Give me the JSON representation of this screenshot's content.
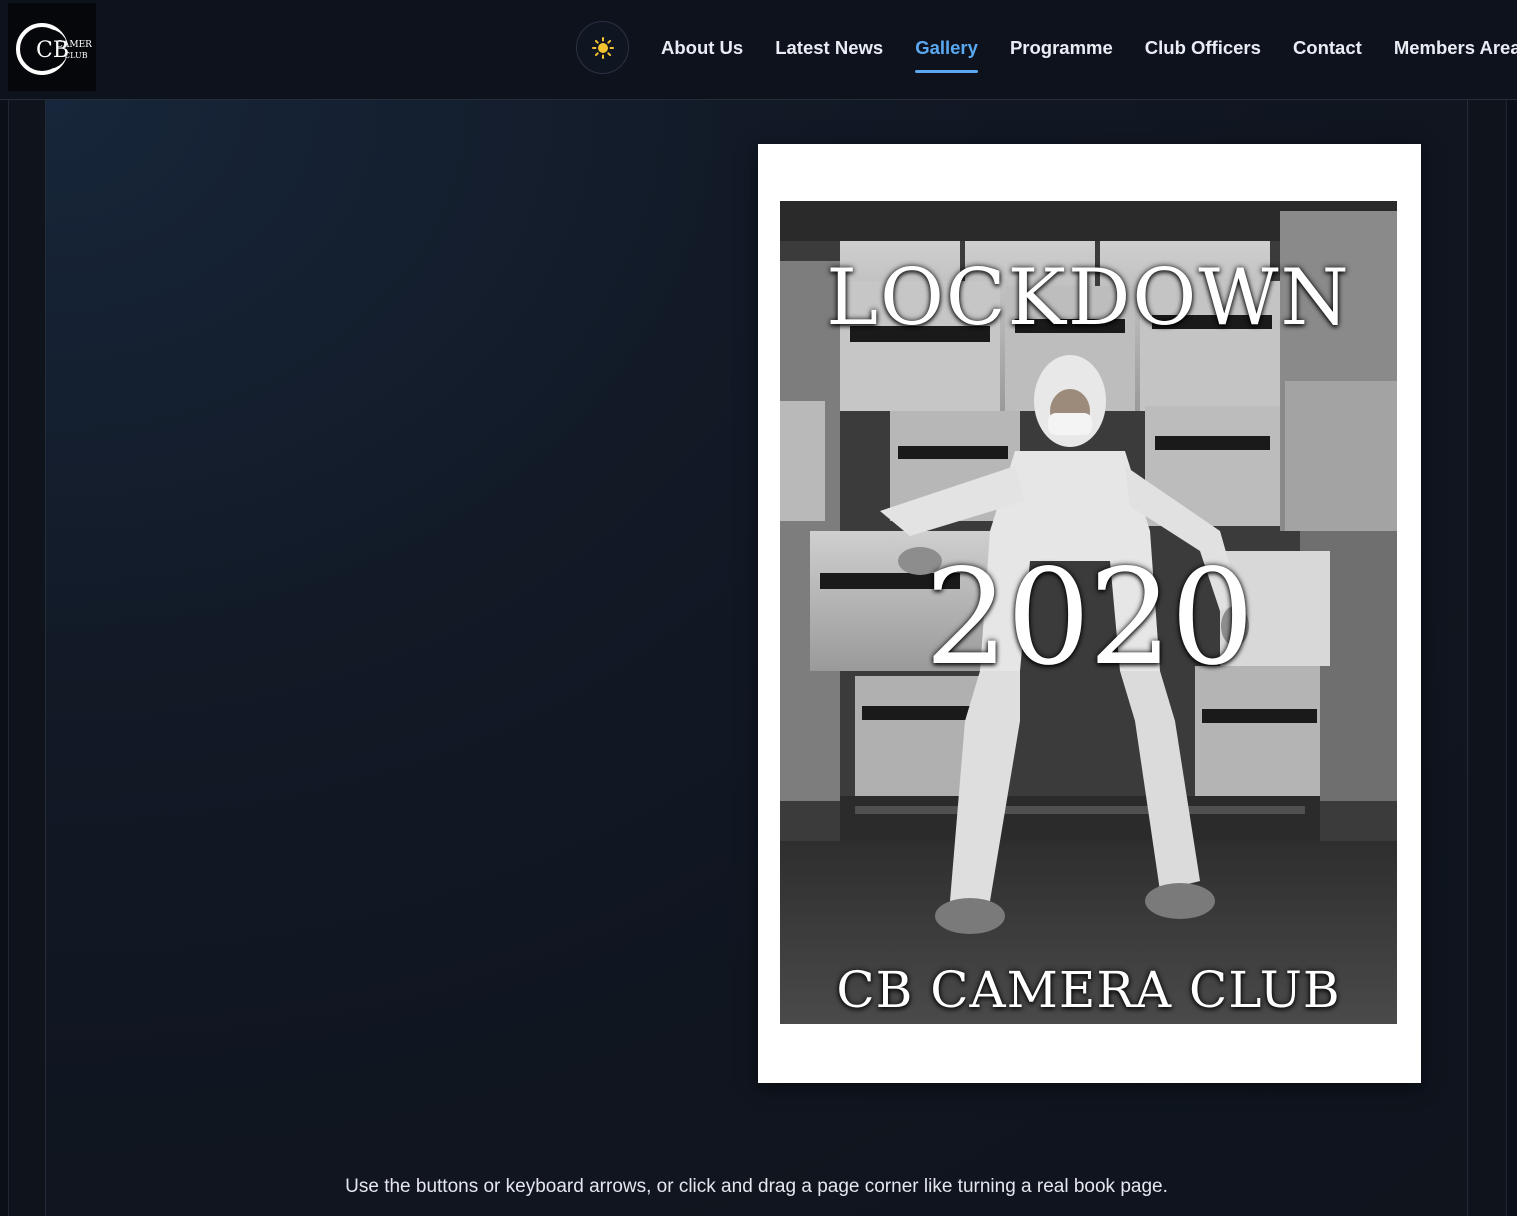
{
  "header": {
    "logo": {
      "text_top": "CAMERA",
      "text_bottom": "CLUB",
      "monogram": "CB"
    },
    "theme_toggle_icon": "sun-icon",
    "nav": [
      {
        "label": "About Us",
        "active": false
      },
      {
        "label": "Latest News",
        "active": false
      },
      {
        "label": "Gallery",
        "active": true
      },
      {
        "label": "Programme",
        "active": false
      },
      {
        "label": "Club Officers",
        "active": false
      },
      {
        "label": "Contact",
        "active": false
      },
      {
        "label": "Members Area",
        "active": false
      }
    ]
  },
  "flipbook": {
    "cover": {
      "title_line1": "LOCKDOWN",
      "title_line2": "2020",
      "title_line3": "CB CAMERA CLUB"
    },
    "instructions": "Use the buttons or keyboard arrows, or click and drag a page corner like turning a real book page."
  },
  "colors": {
    "accent": "#5aa8f0",
    "header_bg": "#0d121d",
    "page_bg": "#0e131c"
  }
}
